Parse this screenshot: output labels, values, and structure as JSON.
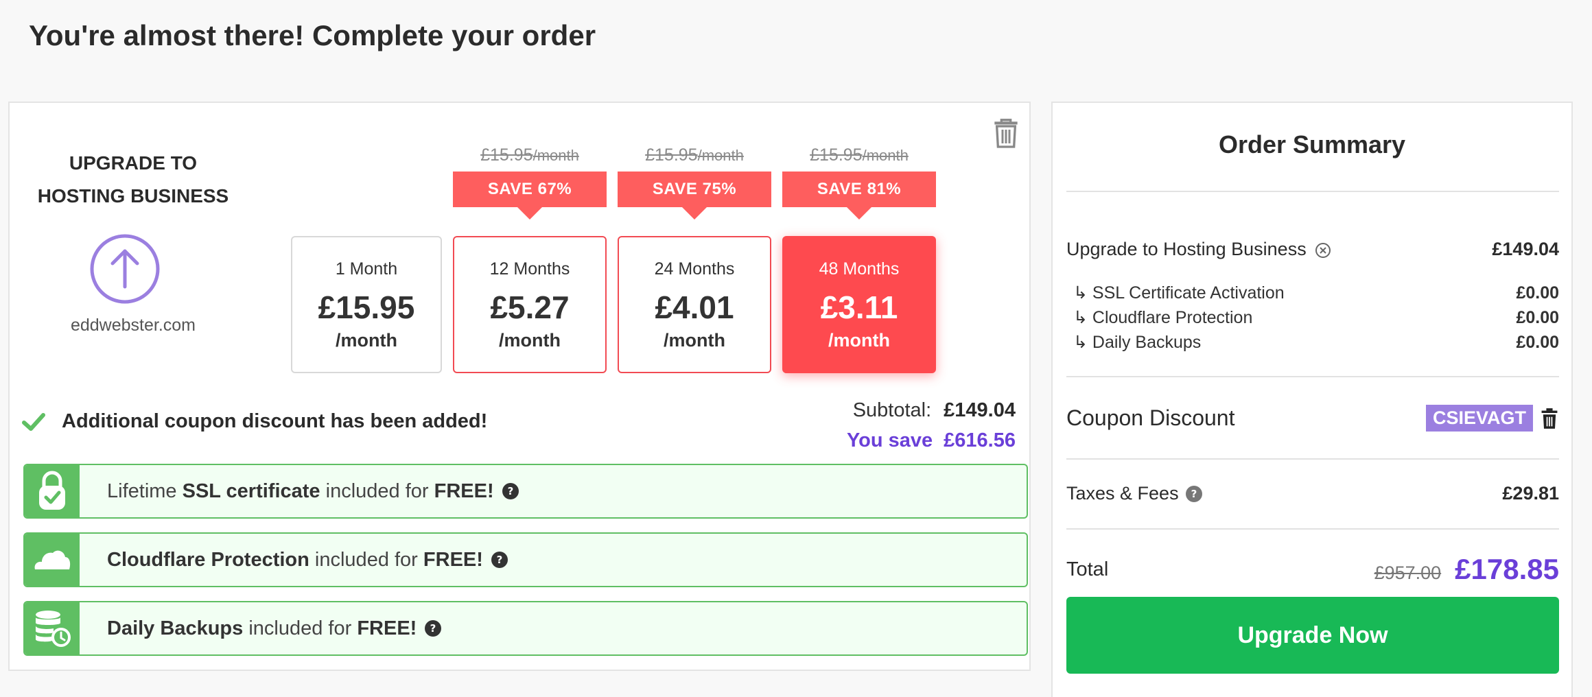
{
  "page": {
    "title": "You're almost there! Complete your order"
  },
  "product": {
    "title_line1": "UPGRADE TO",
    "title_line2": "HOSTING BUSINESS",
    "domain": "eddwebster.com"
  },
  "plans": [
    {
      "term": "1 Month",
      "price": "£15.95",
      "per": "/month",
      "old_price": "",
      "old_per": "",
      "save": ""
    },
    {
      "term": "12 Months",
      "price": "£5.27",
      "per": "/month",
      "old_price": "£15.95",
      "old_per": "/month",
      "save": "SAVE 67%"
    },
    {
      "term": "24 Months",
      "price": "£4.01",
      "per": "/month",
      "old_price": "£15.95",
      "old_per": "/month",
      "save": "SAVE 75%"
    },
    {
      "term": "48 Months",
      "price": "£3.11",
      "per": "/month",
      "old_price": "£15.95",
      "old_per": "/month",
      "save": "SAVE 81%",
      "selected": true
    }
  ],
  "coupon_message": "Additional coupon discount has been added!",
  "totals": {
    "subtotal_label": "Subtotal:",
    "subtotal_value": "£149.04",
    "save_label": "You save",
    "save_value": "£616.56"
  },
  "features": [
    {
      "pre": "Lifetime ",
      "bold": "SSL certificate",
      "mid": " included for ",
      "bold2": "FREE!",
      "icon": "lock-check-icon"
    },
    {
      "pre": "",
      "bold": "Cloudflare Protection",
      "mid": " included for ",
      "bold2": "FREE!",
      "icon": "cloud-icon"
    },
    {
      "pre": "",
      "bold": "Daily Backups",
      "mid": " included for ",
      "bold2": "FREE!",
      "icon": "database-backup-icon"
    }
  ],
  "summary": {
    "title": "Order Summary",
    "main_item": {
      "label": "Upgrade to Hosting Business",
      "value": "£149.04"
    },
    "sub_items": [
      {
        "label": "↳ SSL Certificate Activation",
        "value": "£0.00"
      },
      {
        "label": "↳ Cloudflare Protection",
        "value": "£0.00"
      },
      {
        "label": "↳ Daily Backups",
        "value": "£0.00"
      }
    ],
    "coupon_label": "Coupon Discount",
    "coupon_code": "CSIEVAGT",
    "taxes_label": "Taxes & Fees",
    "taxes_value": "£29.81",
    "total_label": "Total",
    "total_old": "£957.00",
    "total_new": "£178.85",
    "button_label": "Upgrade Now"
  },
  "colors": {
    "accent_red": "#fe4a4f",
    "badge_red": "#fe5e5e",
    "green": "#5fbf63",
    "button_green": "#18b956",
    "purple": "#6a3fd8",
    "coupon_purple": "#9b7fe0"
  }
}
